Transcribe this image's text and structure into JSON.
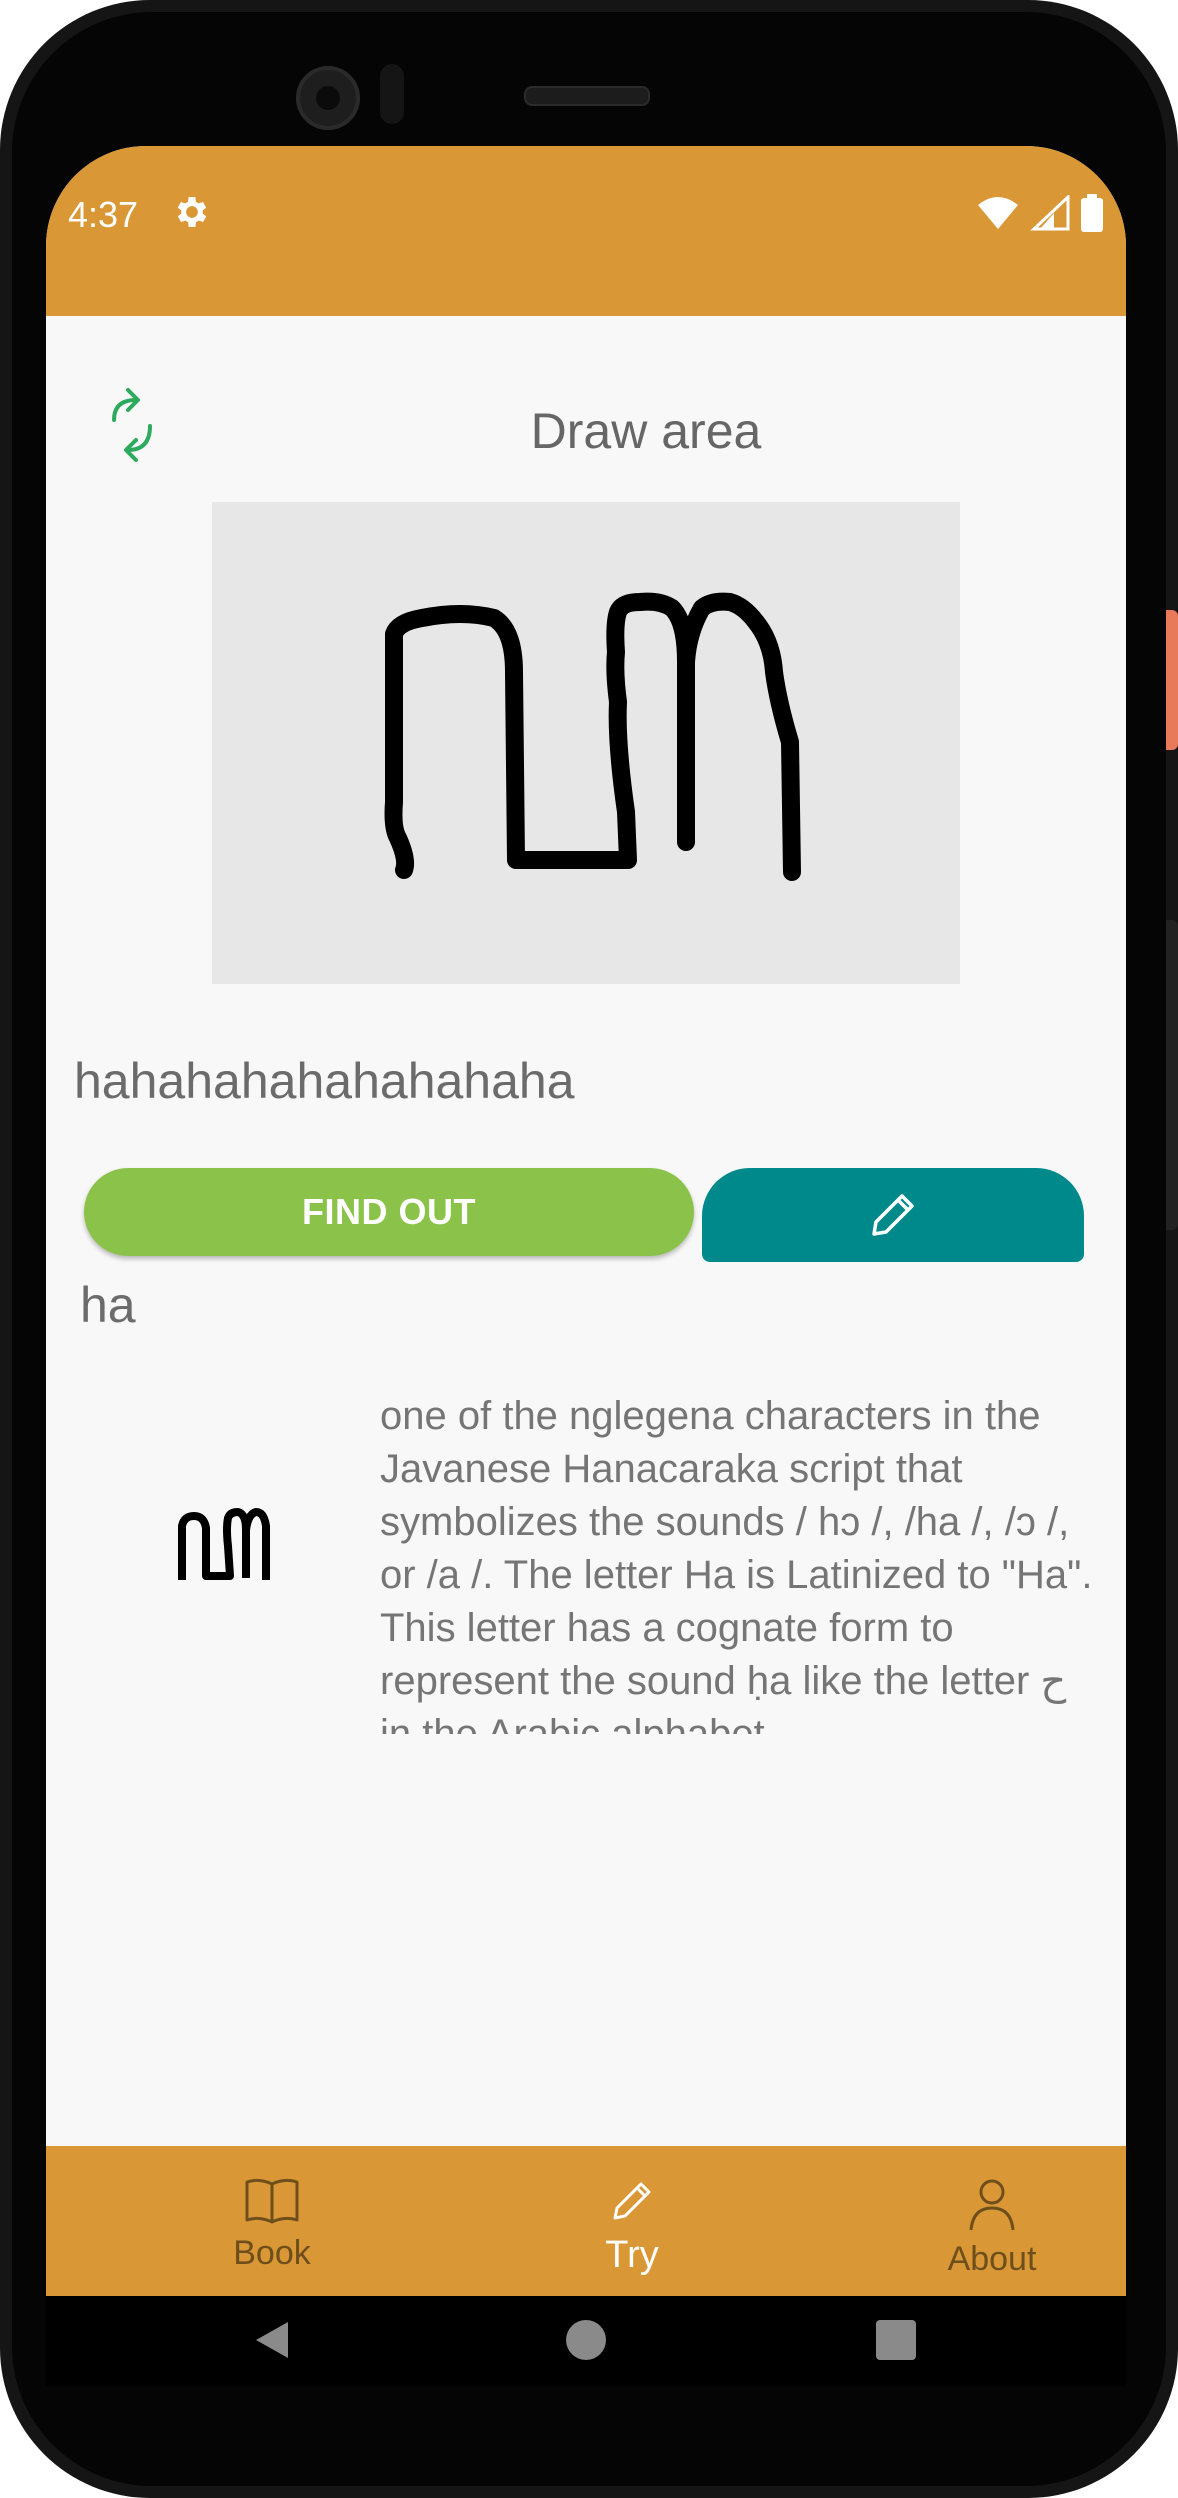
{
  "status_bar": {
    "time": "4:37",
    "gear_icon": "gear-icon",
    "wifi_icon": "wifi-icon",
    "signal_icon": "signal-icon",
    "battery_icon": "battery-icon"
  },
  "draw": {
    "title": "Draw area",
    "refresh_icon": "refresh-icon"
  },
  "result": {
    "recognized_text": "hahahahahahahahaha",
    "find_button_label": "FIND OUT",
    "edit_icon": "pencil-icon",
    "letter_name": "ha",
    "description": "one of the nglegena characters in the Javanese Hanacaraka script that symbolizes the sounds / hɔ /, /ha /, /ɔ /, or /a /. The letter Ha is Latinized to \"Ha\". This letter has a cognate form to represent the sound ḥa like the letter ح in the Arabic alphabet."
  },
  "bottom_nav": {
    "items": [
      {
        "label": "Book",
        "icon": "book-icon"
      },
      {
        "label": "Try",
        "icon": "pencil-icon",
        "active": true
      },
      {
        "label": "About",
        "icon": "person-icon"
      }
    ]
  },
  "colors": {
    "bar": "#d99736",
    "find_button": "#8bc34a",
    "edit_button": "#00898a",
    "refresh_icon": "#2eaa5e"
  }
}
